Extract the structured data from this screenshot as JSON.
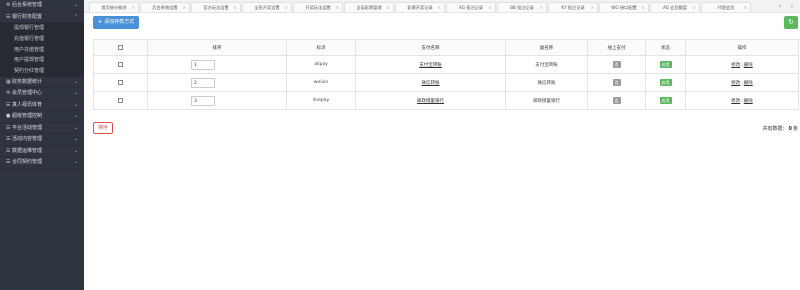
{
  "sidebar": {
    "items": [
      {
        "label": "后台系统管理",
        "icon": "gear-icon",
        "glyph": "⚙",
        "chevron": "⌄"
      },
      {
        "label": "银行财务配置",
        "icon": "list-icon",
        "glyph": "☰",
        "chevron": "⌃",
        "children": [
          "提现银行管理",
          "充值银行管理",
          "用户充值管理",
          "用户提现管理",
          "契约分红管理"
        ]
      },
      {
        "label": "财务数据统计",
        "icon": "chart-icon",
        "glyph": "▦",
        "chevron": "⌄"
      },
      {
        "label": "会员管理中心",
        "icon": "settings-icon",
        "glyph": "✲",
        "chevron": "⌄"
      },
      {
        "label": "真人视讯体育",
        "icon": "list-icon",
        "glyph": "☰",
        "chevron": "⌄"
      },
      {
        "label": "超级管理控制",
        "icon": "user-icon",
        "glyph": "●",
        "chevron": "⌄"
      },
      {
        "label": "平台活动管理",
        "icon": "list-icon",
        "glyph": "☰",
        "chevron": "⌄"
      },
      {
        "label": "活动内容管理",
        "icon": "list-icon",
        "glyph": "☰",
        "chevron": "⌄"
      },
      {
        "label": "数据运维管理",
        "icon": "list-icon",
        "glyph": "☰",
        "chevron": "⌄"
      },
      {
        "label": "合同契约管理",
        "icon": "list-icon",
        "glyph": "☰",
        "chevron": "⌄"
      }
    ],
    "collapse_glyph": "‹"
  },
  "tabs": {
    "items": [
      "首页统计概述",
      "后台系统设置",
      "官方玩法设置",
      "全民开奖设置",
      "开奖玩法设置",
      "全局彩票管理",
      "彩票开奖记录",
      "AG 投注记录",
      "BB 投注记录",
      "KY 投注记录",
      "WG 接口配置",
      "AG 会员额度",
      "代理会员"
    ],
    "close_glyph": "×",
    "prev_glyph": "‹",
    "next_glyph": "›"
  },
  "toolbar": {
    "add_label": "添加存款方式",
    "add_glyph": "+",
    "refresh_glyph": "↻"
  },
  "table": {
    "columns": [
      "",
      "排序",
      "标识",
      "支付名称",
      "副名称",
      "线上支付",
      "状态",
      "操作"
    ],
    "rows": [
      {
        "sort": "1",
        "code": "alipay",
        "name": "支付宝转账",
        "alias": "支付宝转账",
        "online": "否",
        "status": "启用",
        "edit": "修改",
        "delete": "删除"
      },
      {
        "sort": "2",
        "code": "weixin",
        "name": "微信转账",
        "alias": "微信转账",
        "online": "否",
        "status": "启用",
        "edit": "修改",
        "delete": "删除"
      },
      {
        "sort": "3",
        "code": "linepay",
        "name": "邮政储蓄银行",
        "alias": "邮政储蓄银行",
        "online": "否",
        "status": "启用",
        "edit": "修改",
        "delete": "删除"
      }
    ],
    "op_separator": "|"
  },
  "footer": {
    "sort_label": "排序",
    "total_prefix": "共有数据：",
    "total_count": "0",
    "total_suffix": "条"
  },
  "colors": {
    "sidebar_bg": "#2f3540",
    "primary": "#4a90d9",
    "success": "#5cb85c",
    "danger": "#d9534f"
  }
}
